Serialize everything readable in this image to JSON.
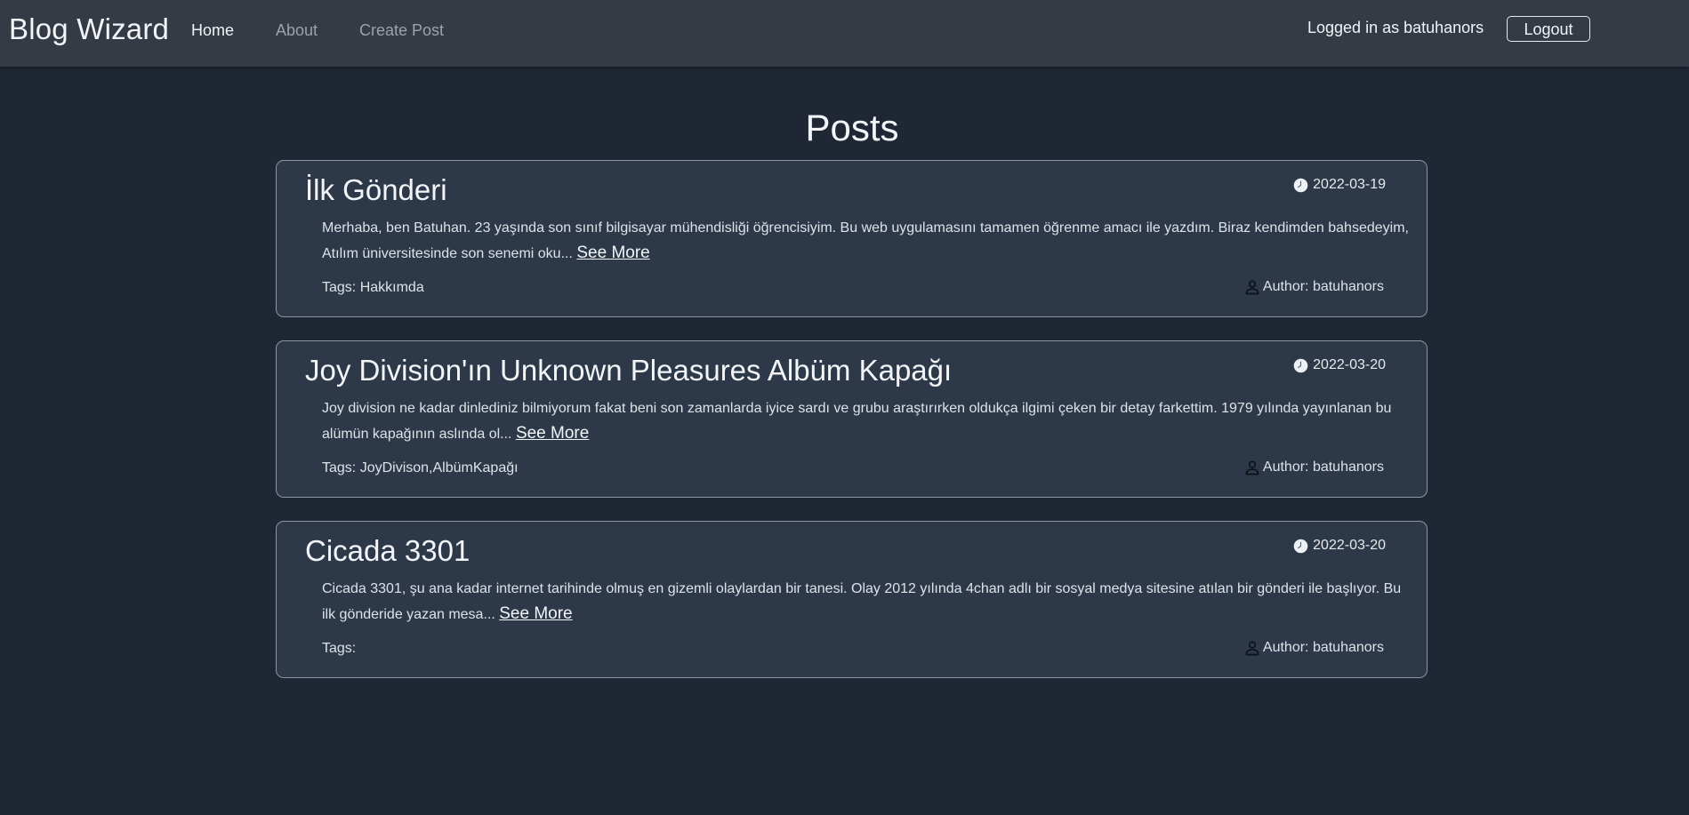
{
  "nav": {
    "brand": "Blog Wizard",
    "links": [
      "Home",
      "About",
      "Create Post"
    ],
    "logged_in_text": "Logged in as batuhanors",
    "logout_label": "Logout"
  },
  "page": {
    "heading": "Posts"
  },
  "posts": [
    {
      "title": "İlk Gönderi",
      "date": "2022-03-19",
      "excerpt": "Merhaba, ben Batuhan. 23 yaşında son sınıf bilgisayar mühendisliği öğrencisiyim. Bu web uygulamasını tamamen öğrenme amacı ile yazdım. Biraz kendimden bahsedeyim, Atılım üniversitesinde son senemi oku...",
      "see_more": "See More",
      "tags": "Tags: Hakkımda",
      "author": "Author: batuhanors"
    },
    {
      "title": "Joy Division'ın Unknown Pleasures Albüm Kapağı",
      "date": "2022-03-20",
      "excerpt": "Joy division ne kadar dinlediniz bilmiyorum fakat beni son zamanlarda iyice sardı ve grubu araştırırken oldukça ilgimi çeken bir detay farkettim. 1979 yılında yayınlanan bu alümün kapağının aslında ol...",
      "see_more": "See More",
      "tags": "Tags: JoyDivison,AlbümKapağı",
      "author": "Author: batuhanors"
    },
    {
      "title": "Cicada 3301",
      "date": "2022-03-20",
      "excerpt": "Cicada 3301, şu ana kadar internet tarihinde olmuş en gizemli olaylardan bir tanesi. Olay 2012 yılında 4chan adlı bir sosyal medya sitesine atılan bir gönderi ile başlıyor. Bu ilk gönderide yazan mesa...",
      "see_more": "See More",
      "tags": "Tags:",
      "author": "Author: batuhanors"
    }
  ],
  "icons": {
    "date": "clock-icon",
    "author": "person-icon"
  },
  "colors": {
    "background": "#1e2733",
    "navbar": "#343b44",
    "card": "#2d3949",
    "card_border": "#8c96a3"
  }
}
